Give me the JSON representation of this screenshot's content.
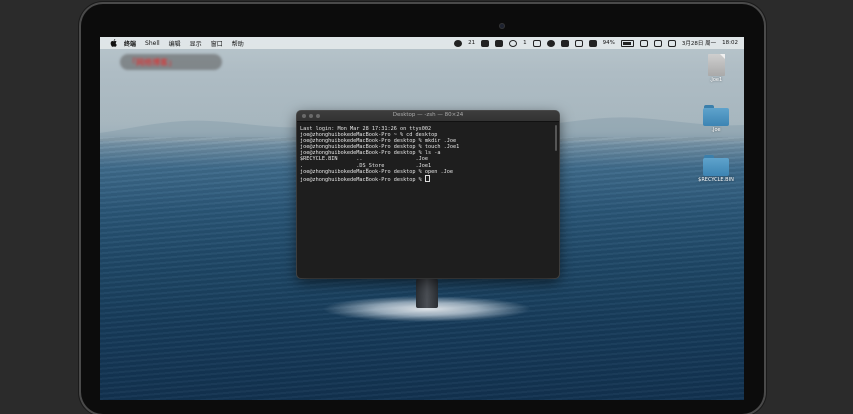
{
  "menubar": {
    "app_name": "终端",
    "menus": [
      "Shell",
      "编辑",
      "显示",
      "窗口",
      "帮助"
    ],
    "status": {
      "wechat_count": "21",
      "count_b": "1",
      "battery_percent": "94%",
      "battery_level": 0.94,
      "datetime": "3月28日 周一",
      "time": "18:02"
    }
  },
  "watermark": {
    "text": "「网络博客」"
  },
  "terminal": {
    "title": "Desktop — -zsh — 80×24",
    "lines": [
      "Last login: Mon Mar 28 17:31:26 on ttys002",
      "joe@zhonghuibokedeMacBook-Pro ~ % cd desktop",
      "joe@zhonghuibokedeMacBook-Pro desktop % mkdir .Joe",
      "joe@zhonghuibokedeMacBook-Pro desktop % touch .Joe1",
      "joe@zhonghuibokedeMacBook-Pro desktop % ls -a",
      "$RECYCLE.BIN      ..                 .Joe",
      ".                 .DS_Store          .Joe1",
      "joe@zhonghuibokedeMacBook-Pro desktop % open .Joe"
    ],
    "prompt": "joe@zhonghuibokedeMacBook-Pro desktop % "
  },
  "desktop_icons": [
    {
      "type": "file",
      "label": ".Joe1"
    },
    {
      "type": "folder",
      "label": ".Joe"
    },
    {
      "type": "folder",
      "label": "$RECYCLE.BIN"
    }
  ]
}
